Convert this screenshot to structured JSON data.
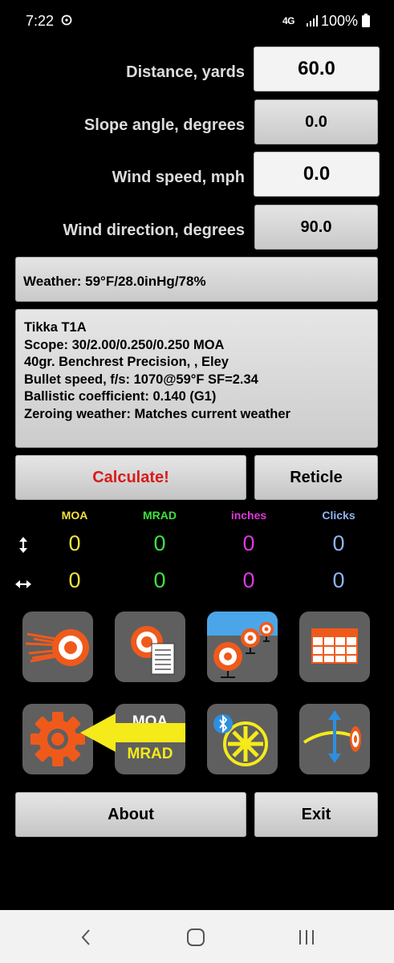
{
  "status_bar": {
    "time": "7:22",
    "network": "4G",
    "battery": "100%"
  },
  "inputs": {
    "distance": {
      "label": "Distance, yards",
      "value": "60.0"
    },
    "slope": {
      "label": "Slope angle, degrees",
      "value": "0.0"
    },
    "wind_speed": {
      "label": "Wind speed, mph",
      "value": "0.0"
    },
    "wind_direction": {
      "label": "Wind direction, degrees",
      "value": "90.0"
    }
  },
  "weather": {
    "text": "Weather: 59°F/28.0inHg/78%"
  },
  "profile": {
    "lines": [
      "Tikka T1A",
      "Scope: 30/2.00/0.250/0.250 MOA",
      "40gr. Benchrest Precision, , Eley",
      "Bullet speed, f/s: 1070@59°F SF=2.34",
      "Ballistic coefficient: 0.140 (G1)",
      "Zeroing weather: Matches current weather"
    ]
  },
  "buttons": {
    "calculate": "Calculate!",
    "reticle": "Reticle",
    "about": "About",
    "exit": "Exit"
  },
  "results": {
    "headers": [
      "MOA",
      "MRAD",
      "inches",
      "Clicks"
    ],
    "vertical": [
      "0",
      "0",
      "0",
      "0"
    ],
    "horizontal": [
      "0",
      "0",
      "0",
      "0"
    ]
  },
  "icon_grid": {
    "units_icon_top": "MOA",
    "units_icon_bottom": "MRAD"
  },
  "colors": {
    "moa": "#f2e33c",
    "mrad": "#3fe23f",
    "inches": "#dd38dd",
    "clicks": "#8fb4f2",
    "calculate": "#d81b1b",
    "target_orange": "#ef5a1b",
    "highlight_arrow": "#f5ea1a"
  }
}
